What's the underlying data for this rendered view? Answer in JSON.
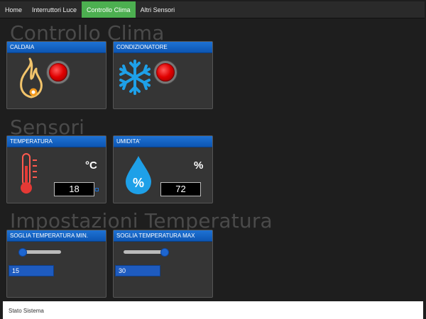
{
  "nav": {
    "items": [
      {
        "label": "Home",
        "active": false
      },
      {
        "label": "Interruttori Luce",
        "active": false
      },
      {
        "label": "Controllo Clima",
        "active": true
      },
      {
        "label": "Altri Sensori",
        "active": false
      }
    ]
  },
  "sections": {
    "clima": "Controllo Clima",
    "sensori": "Sensori",
    "impostazioni": "Impostazioni Temperatura"
  },
  "cards": {
    "caldaia": {
      "title": "CALDAIA",
      "icon": "flame-icon",
      "led_state": "off"
    },
    "condizionatore": {
      "title": "CONDIZIONATORE",
      "icon": "snowflake-icon",
      "led_state": "off"
    },
    "temperatura": {
      "title": "TEMPERATURA",
      "icon": "thermometer-icon",
      "unit": "°C",
      "value": "18"
    },
    "umidita": {
      "title": "UMIDITA'",
      "icon": "humidity-drop-icon",
      "unit": "%",
      "value": "72"
    },
    "soglia_min": {
      "title": "SOGLIA TEMPERATURA MIN.",
      "value": "15",
      "slider_fraction": 0.0
    },
    "soglia_max": {
      "title": "SOGLIA TEMPERATURA MAX",
      "value": "30",
      "slider_fraction": 1.0
    }
  },
  "status": {
    "label": "Stato Sistema"
  },
  "colors": {
    "accent_green": "#4caf50",
    "header_blue": "#1565c0",
    "led_red": "#e00000",
    "icon_blue": "#1ea0e8"
  }
}
